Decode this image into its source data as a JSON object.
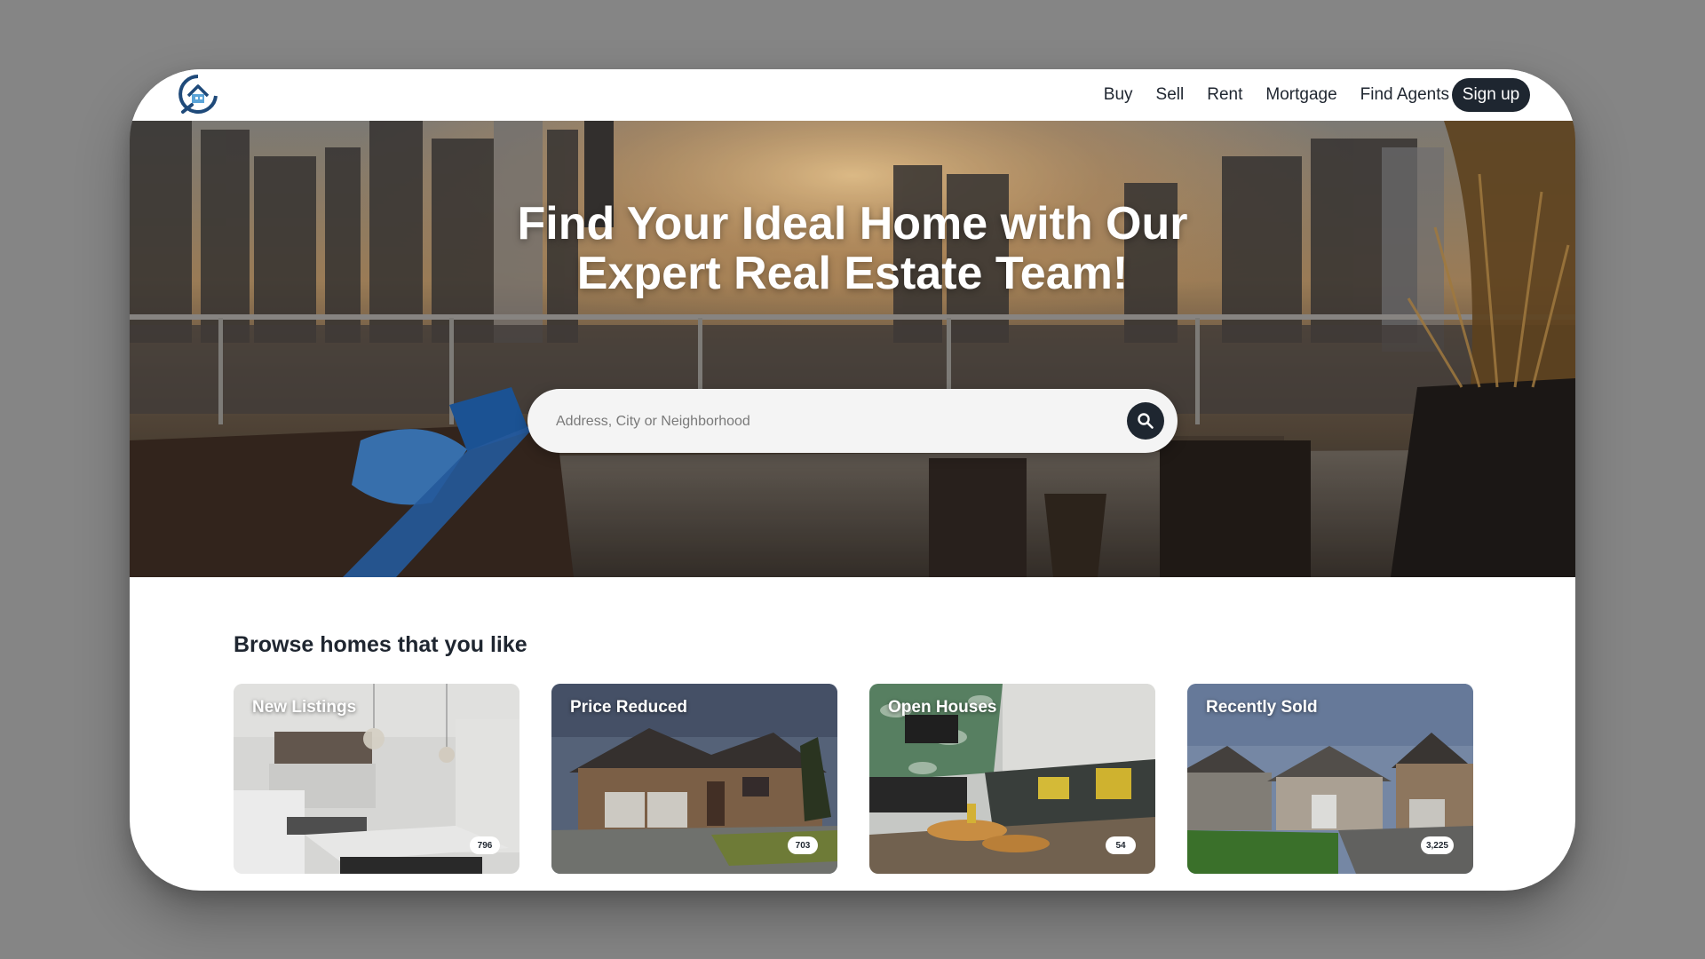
{
  "nav": {
    "logo_icon": "house-chat-logo-icon",
    "links": [
      {
        "label": "Buy"
      },
      {
        "label": "Sell"
      },
      {
        "label": "Rent"
      },
      {
        "label": "Mortgage"
      },
      {
        "label": "Find Agents"
      }
    ],
    "signup_label": "Sign up"
  },
  "hero": {
    "title_line1": "Find Your Ideal Home with Our",
    "title_line2": "Expert Real Estate Team!",
    "search_placeholder": "Address, City or Neighborhood",
    "search_icon": "search-icon"
  },
  "browse": {
    "heading": "Browse homes that you like",
    "cards": [
      {
        "label": "New Listings",
        "count": "796"
      },
      {
        "label": "Price Reduced",
        "count": "703"
      },
      {
        "label": "Open Houses",
        "count": "54"
      },
      {
        "label": "Recently Sold",
        "count": "3,225"
      }
    ]
  },
  "colors": {
    "primary_dark": "#1e2630",
    "page_background": "#858585",
    "card_background": "#ffffff"
  }
}
